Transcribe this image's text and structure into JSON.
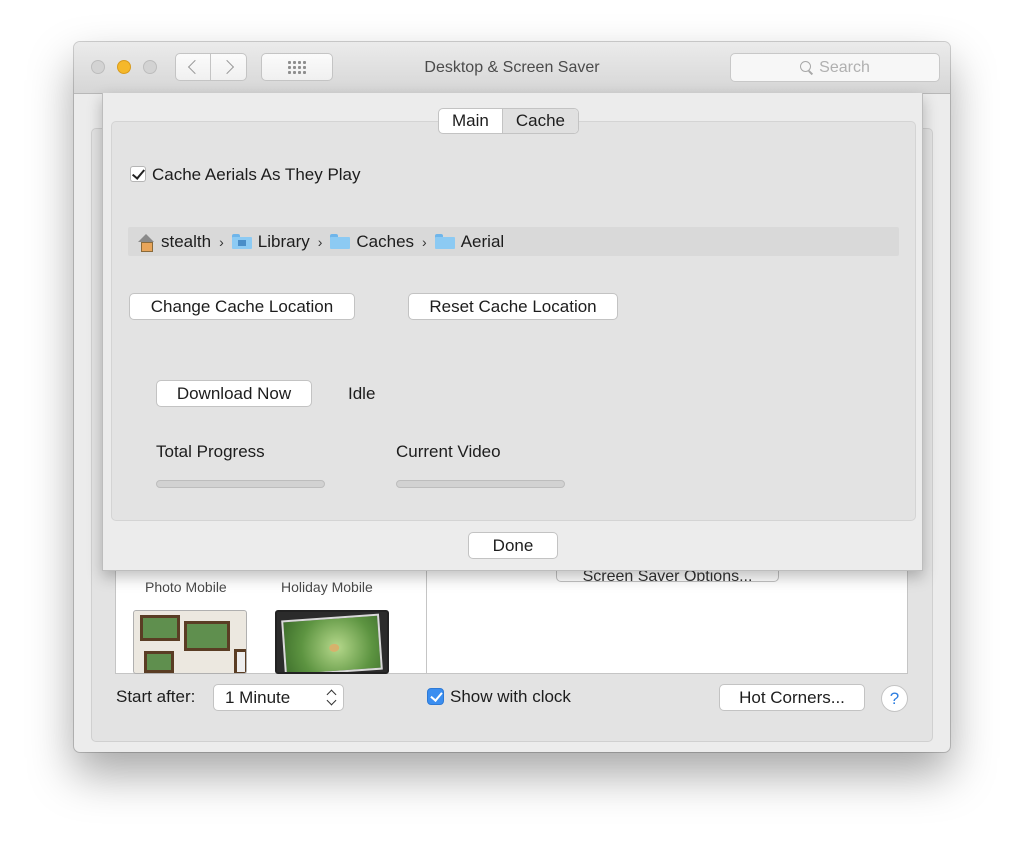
{
  "window": {
    "title": "Desktop & Screen Saver",
    "search_placeholder": "Search"
  },
  "background": {
    "savers": [
      {
        "label": "Photo Mobile"
      },
      {
        "label": "Holiday Mobile"
      }
    ],
    "options_button": "Screen Saver Options...",
    "start_after_label": "Start after:",
    "start_after_value": "1 Minute",
    "show_clock_label": "Show with clock",
    "show_clock_checked": true,
    "hot_corners_button": "Hot Corners...",
    "help_label": "?"
  },
  "sheet": {
    "tabs": [
      {
        "label": "Main",
        "selected": false
      },
      {
        "label": "Cache",
        "selected": true
      }
    ],
    "cache_checkbox_label": "Cache Aerials As They Play",
    "cache_checkbox_checked": true,
    "path": [
      {
        "label": "stealth",
        "icon": "home-icon"
      },
      {
        "label": "Library",
        "icon": "library-folder-icon"
      },
      {
        "label": "Caches",
        "icon": "folder-icon"
      },
      {
        "label": "Aerial",
        "icon": "folder-icon"
      }
    ],
    "path_separator": "›",
    "change_cache_button": "Change Cache Location",
    "reset_cache_button": "Reset Cache Location",
    "download_button": "Download Now",
    "status": "Idle",
    "total_progress_label": "Total Progress",
    "total_progress_value": 0,
    "current_video_label": "Current Video",
    "current_video_value": 0,
    "done_button": "Done"
  }
}
